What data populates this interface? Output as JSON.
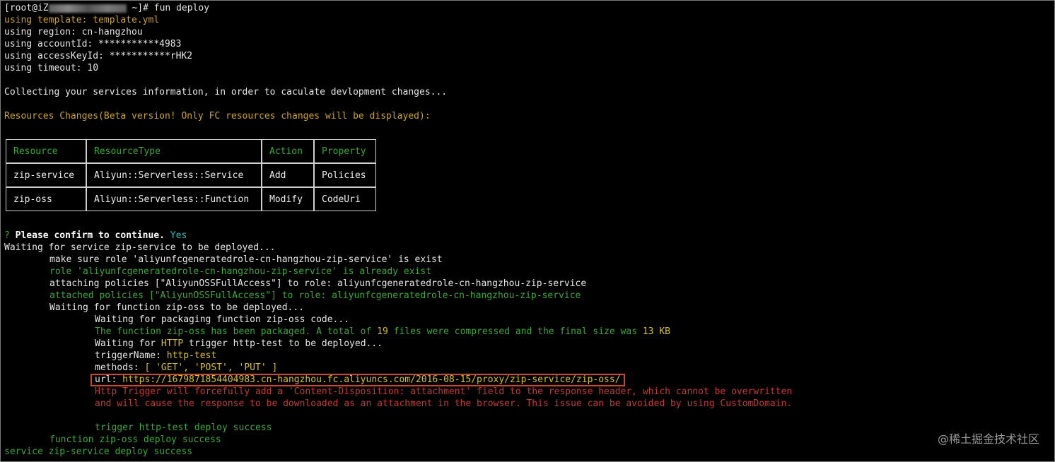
{
  "prompt": {
    "user": "[root@iZ",
    "suffix": " ~]#",
    "command": " fun deploy"
  },
  "header_lines": [
    "using template: template.yml",
    "using region: cn-hangzhou",
    "using accountId: ***********4983",
    "using accessKeyId: ***********rHK2",
    "using timeout: 10"
  ],
  "collecting": "Collecting your services information, in order to caculate devlopment changes...",
  "resources_changes": "Resources Changes(Beta version! Only FC resources changes will be displayed):",
  "table": {
    "headers": [
      "Resource",
      "ResourceType",
      "Action",
      "Property"
    ],
    "rows": [
      [
        "zip-service",
        "Aliyun::Serverless::Service",
        "Add",
        "Policies"
      ],
      [
        "zip-oss",
        "Aliyun::Serverless::Function",
        "Modify",
        "CodeUri"
      ]
    ]
  },
  "confirm": {
    "mark": "?",
    "text": " Please confirm to continue.",
    "answer": " Yes"
  },
  "deploy": {
    "waiting_service": "Waiting for service zip-service to be deployed...",
    "make_sure_role": "make sure role 'aliyunfcgeneratedrole-cn-hangzhou-zip-service' is exist",
    "role_exist": "role 'aliyunfcgeneratedrole-cn-hangzhou-zip-service' is already exist",
    "attaching": "attaching policies [\"AliyunOSSFullAccess\"] to role: aliyunfcgeneratedrole-cn-hangzhou-zip-service",
    "attached": "attached policies [\"AliyunOSSFullAccess\"] to role: aliyunfcgeneratedrole-cn-hangzhou-zip-service",
    "waiting_function": "Waiting for function zip-oss to be deployed...",
    "waiting_packaging": "Waiting for packaging function zip-oss code...",
    "packaged_a": "The function zip-oss has been packaged. A total of ",
    "packaged_files": "19",
    "packaged_b": " files were compressed and the final size was ",
    "packaged_size": "13 KB",
    "waiting_for": "Waiting for ",
    "http": "HTTP",
    "trigger_deployed": " trigger http-test to be deployed...",
    "trigger_name_label": "triggerName: ",
    "trigger_name": "http-test",
    "methods_label": "methods: ",
    "methods": "[ 'GET', 'POST', 'PUT' ]",
    "url_label": "url: ",
    "url": "https://1679871854404983.cn-hangzhou.fc.aliyuncs.com/2016-08-15/proxy/zip-service/zip-oss/",
    "warn1": "Http Trigger will forcefully add a 'Content-Disposition: attachment' field to the response header, which cannot be overwritten",
    "warn2": "and will cause the response to be downloaded as an attachment in the browser. This issue can be avoided by using CustomDomain.",
    "trigger_success": "trigger http-test deploy success",
    "function_success": "function zip-oss deploy success",
    "service_success": "service zip-service deploy success"
  },
  "watermark": "@稀土掘金技术社区"
}
